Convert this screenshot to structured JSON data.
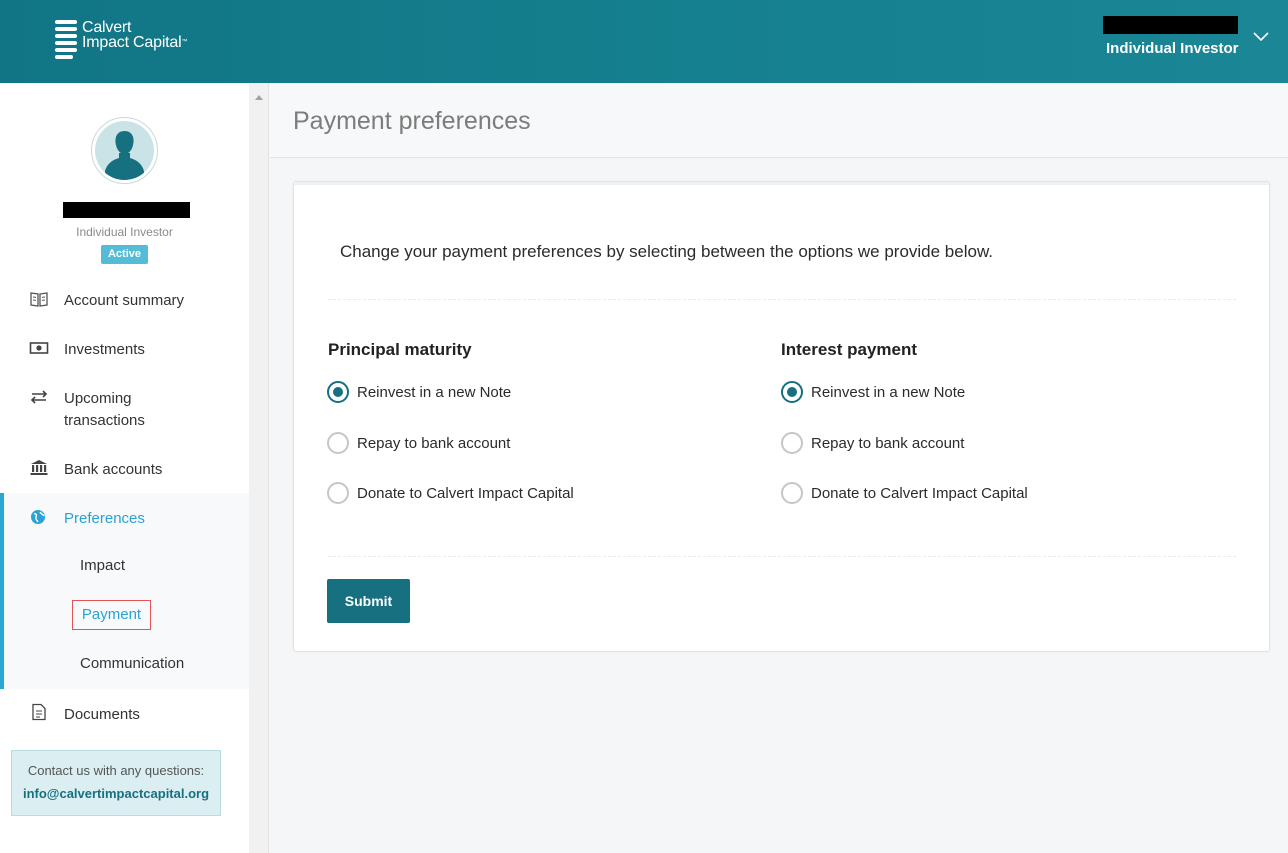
{
  "header": {
    "logo_line1": "Calvert",
    "logo_line2": "Impact Capital",
    "user_role": "Individual Investor"
  },
  "profile": {
    "role": "Individual Investor",
    "status": "Active"
  },
  "sidebar": {
    "items": [
      {
        "label": "Account summary",
        "icon": "book-icon"
      },
      {
        "label": "Investments",
        "icon": "money-icon"
      },
      {
        "label": "Upcoming transactions",
        "icon": "transfer-arrows-icon"
      },
      {
        "label": "Bank accounts",
        "icon": "bank-icon"
      },
      {
        "label": "Preferences",
        "icon": "globe-icon"
      },
      {
        "label": "Documents",
        "icon": "document-icon"
      }
    ],
    "upcoming_line1": "Upcoming",
    "upcoming_line2": "transactions",
    "preferences_sub": [
      "Impact",
      "Payment",
      "Communication"
    ],
    "contact_label": "Contact us with any questions:",
    "contact_email": "info@calvertimpactcapital.org"
  },
  "main": {
    "title": "Payment preferences",
    "intro": "Change your payment preferences by selecting between the options we provide below.",
    "principal": {
      "title": "Principal maturity",
      "options": [
        "Reinvest in a new Note",
        "Repay to bank account",
        "Donate to Calvert Impact Capital"
      ],
      "selected": "Reinvest in a new Note"
    },
    "interest": {
      "title": "Interest payment",
      "options": [
        "Reinvest in a new Note",
        "Repay to bank account",
        "Donate to Calvert Impact Capital"
      ],
      "selected": "Reinvest in a new Note"
    },
    "submit_label": "Submit"
  },
  "colors": {
    "header": "#15808f",
    "accent": "#17707f",
    "active_nav": "#2aa3d4",
    "badge": "#55bcd8"
  }
}
